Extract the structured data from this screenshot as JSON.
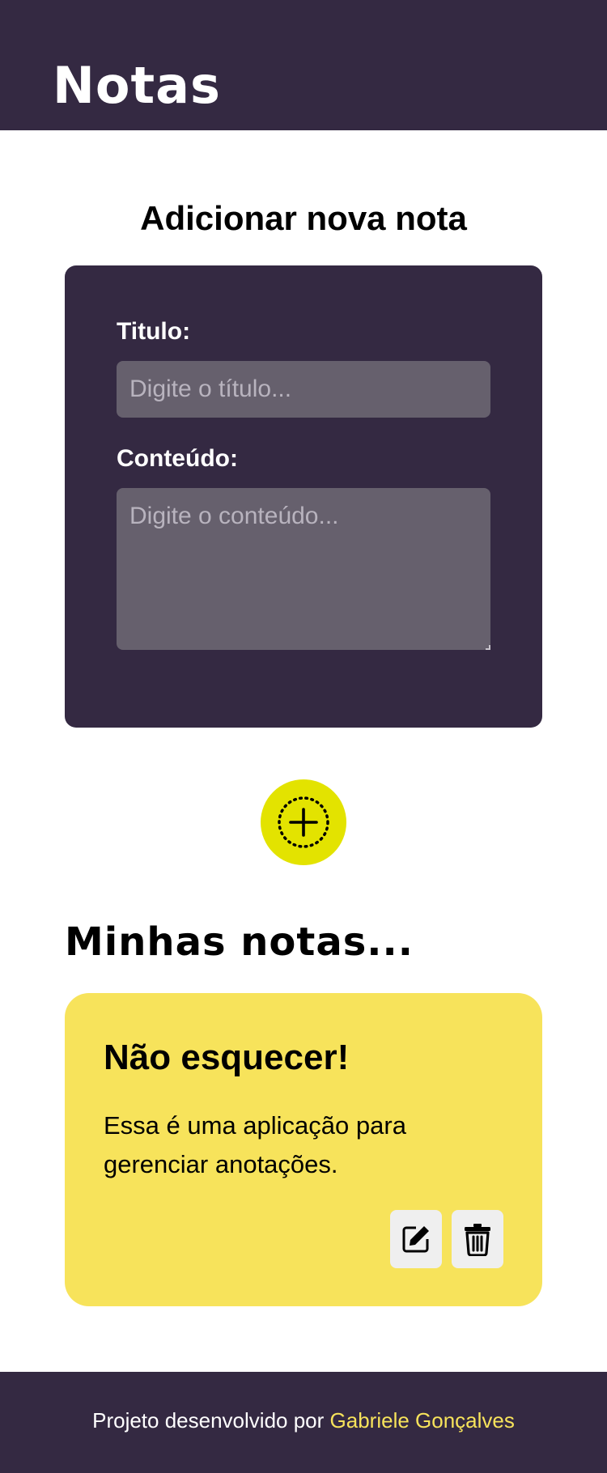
{
  "header": {
    "logo": "Notas"
  },
  "form": {
    "heading": "Adicionar nova nota",
    "title_label": "Titulo:",
    "title_placeholder": "Digite o título...",
    "content_label": "Conteúdo:",
    "content_placeholder": "Digite o conteúdo..."
  },
  "add_button": {
    "icon": "add-circle-dotted-icon"
  },
  "notes": {
    "heading": "Minhas notas...",
    "items": [
      {
        "title": "Não esquecer!",
        "content": "Essa é uma aplicação para gerenciar anotações.",
        "edit_icon": "edit-icon",
        "delete_icon": "trash-icon"
      }
    ]
  },
  "footer": {
    "text": "Projeto desenvolvido por",
    "author": "Gabriele Gonçalves"
  },
  "colors": {
    "primary_dark": "#342942",
    "accent_yellow": "#e3e300",
    "note_yellow": "#f7e35b",
    "input_bg": "#66606d"
  }
}
